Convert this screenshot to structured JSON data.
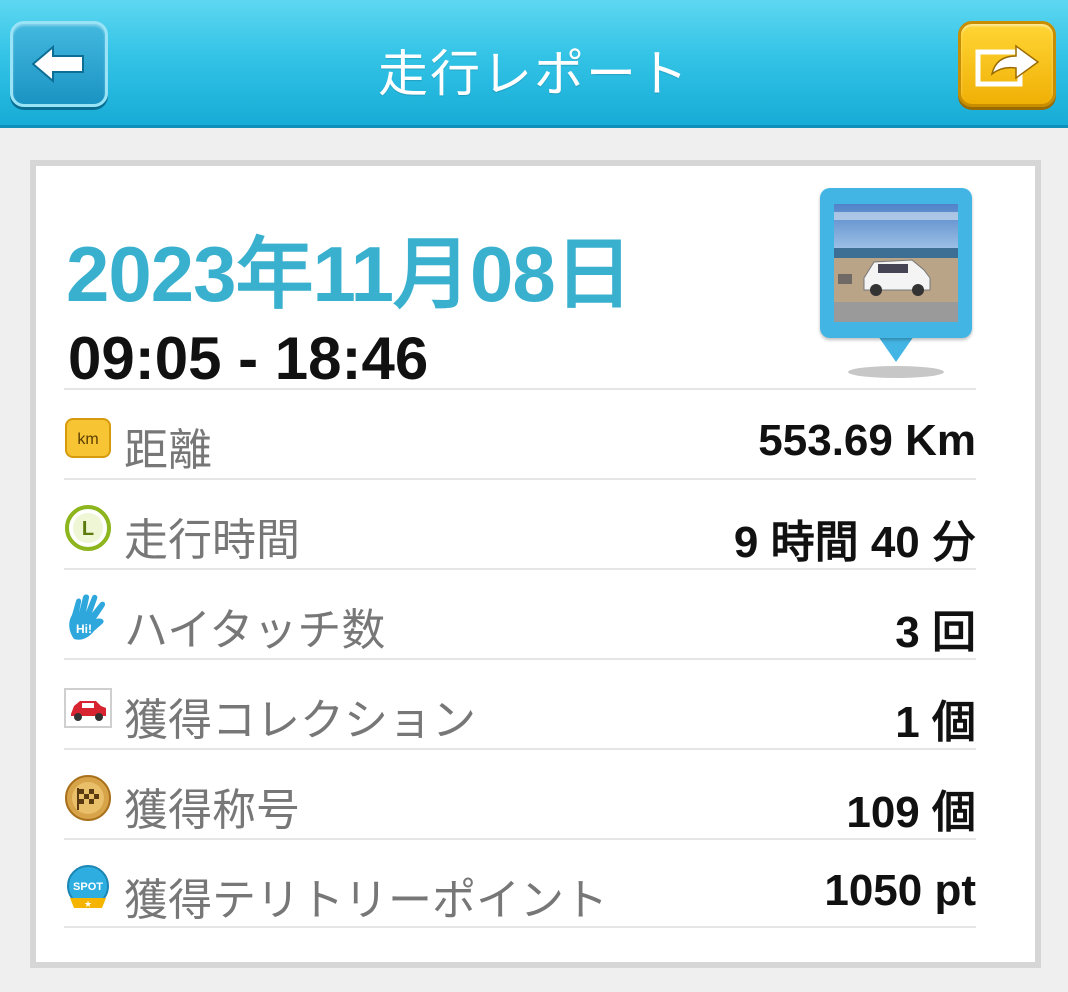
{
  "header": {
    "title": "走行レポート",
    "back_icon": "arrow-left-icon",
    "share_icon": "share-icon",
    "colors": {
      "bar": "#33c3e6",
      "back_button": "#1b93c3",
      "share_button": "#f0b006"
    }
  },
  "report": {
    "date": "2023年11月08日",
    "time_range": "09:05 - 18:46",
    "date_color": "#3ab0cf",
    "photo_icon": "map-pin-photo-icon"
  },
  "stats": [
    {
      "icon": "km-icon",
      "label": "距離",
      "value": "553.69 Km"
    },
    {
      "icon": "clock-icon",
      "label": "走行時間",
      "value": "9 時間 40 分"
    },
    {
      "icon": "hi-five-hand-icon",
      "label": "ハイタッチ数",
      "value": "3 回"
    },
    {
      "icon": "car-collection-icon",
      "label": "獲得コレクション",
      "value": "1 個"
    },
    {
      "icon": "checkered-flag-medal-icon",
      "label": "獲得称号",
      "value": "109 個"
    },
    {
      "icon": "spot-badge-icon",
      "label": "獲得テリトリーポイント",
      "value": "1050 pt"
    }
  ],
  "icon_text": {
    "km": "km",
    "clock": "L",
    "hand": "Hi!",
    "spot": "SPOT"
  }
}
